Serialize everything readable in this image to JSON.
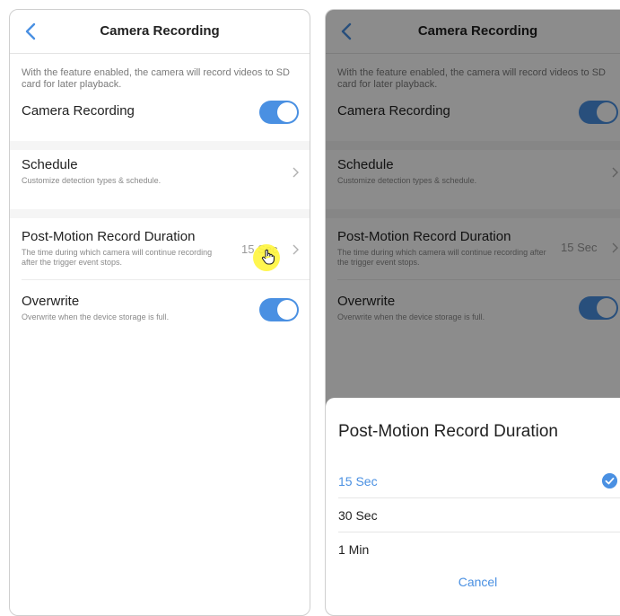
{
  "left": {
    "nav": {
      "title": "Camera Recording"
    },
    "intro": "With the feature enabled, the camera will record videos to SD card for later playback.",
    "camera_recording": {
      "label": "Camera Recording",
      "enabled": true
    },
    "schedule": {
      "label": "Schedule",
      "desc": "Customize detection types & schedule."
    },
    "post_motion": {
      "label": "Post-Motion Record Duration",
      "desc": "The time during which camera will continue recording after the trigger event stops.",
      "value": "15 Sec"
    },
    "overwrite": {
      "label": "Overwrite",
      "desc": "Overwrite when the device storage is full.",
      "enabled": true
    }
  },
  "right": {
    "nav": {
      "title": "Camera Recording"
    },
    "intro": "With the feature enabled, the camera will record videos to SD card for later playback.",
    "camera_recording": {
      "label": "Camera Recording"
    },
    "schedule": {
      "label": "Schedule",
      "desc": "Customize detection types & schedule."
    },
    "post_motion": {
      "label": "Post-Motion Record Duration",
      "desc": "The time during which camera will continue recording after the trigger event stops.",
      "value": "15 Sec"
    },
    "overwrite": {
      "label": "Overwrite",
      "desc": "Overwrite when the device storage is full."
    },
    "sheet": {
      "title": "Post-Motion Record Duration",
      "options": [
        {
          "label": "15 Sec",
          "selected": true
        },
        {
          "label": "30 Sec",
          "selected": false
        },
        {
          "label": "1 Min",
          "selected": false
        }
      ],
      "cancel": "Cancel"
    }
  },
  "colors": {
    "accent": "#4a90e2",
    "overlay": "rgba(0,0,0,0.45)",
    "pointer_highlight": "#fff53c"
  },
  "icons": [
    "back-chevron-icon",
    "chevron-right-icon",
    "check-circle-icon",
    "hand-pointer-icon"
  ]
}
